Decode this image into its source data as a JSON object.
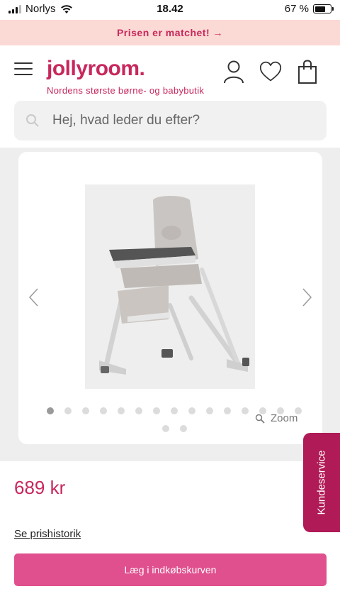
{
  "status_bar": {
    "carrier": "Norlys",
    "time": "18.42",
    "battery": "67 %",
    "battery_level": 0.67
  },
  "promo": {
    "text": "Prisen er matchet! →"
  },
  "header": {
    "logo": "jollyroom.",
    "tagline": "Nordens største børne- og babybutik",
    "icons": [
      "menu-icon",
      "account-icon",
      "wishlist-heart-icon",
      "shopping-bag-icon"
    ]
  },
  "search": {
    "placeholder": "Hej, hvad leder du efter?",
    "value": ""
  },
  "gallery": {
    "image_subject": "high-chair",
    "dot_count": 17,
    "active_dot": 1,
    "zoom_label": "Zoom"
  },
  "product": {
    "price": "689 kr",
    "price_history_link": "Se prishistorik",
    "add_to_cart": "Læg i indkøbskurven"
  },
  "customer_service": {
    "label": "Kundeservice"
  },
  "colors": {
    "brand": "#c8285c",
    "cart_button": "#e04f8e",
    "promo_bg": "#fbd9d4",
    "cs_tab": "#b01a56"
  }
}
